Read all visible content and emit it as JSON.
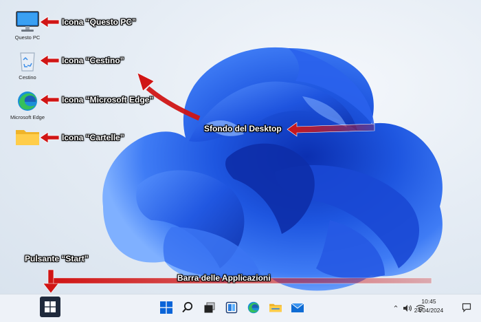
{
  "desktop": {
    "icons": [
      {
        "label": "Questo PC"
      },
      {
        "label": "Cestino"
      },
      {
        "label": "Microsoft Edge"
      },
      {
        "label": ""
      }
    ]
  },
  "annotations": {
    "questo_pc": "Icona “Questo PC”",
    "cestino": "Icona “Cestino”",
    "edge": "Icona “Microsoft Edge”",
    "cartelle": "Icona “Cartelle”",
    "sfondo": "Sfondo del Desktop",
    "start": "Pulsante “Start”",
    "barra": "Barra delle Applicazioni"
  },
  "taskbar": {
    "pinned": [
      "windows-icon",
      "search-icon",
      "task-view-icon",
      "widgets-icon",
      "edge-icon",
      "file-explorer-icon",
      "mail-icon"
    ],
    "clock_time": "10:45",
    "clock_date": "24/04/2024"
  },
  "colors": {
    "annotation_arrow": "#d01515",
    "windows_blue": "#0a64d8",
    "wallpaper_blue": "#1f4fd6"
  }
}
